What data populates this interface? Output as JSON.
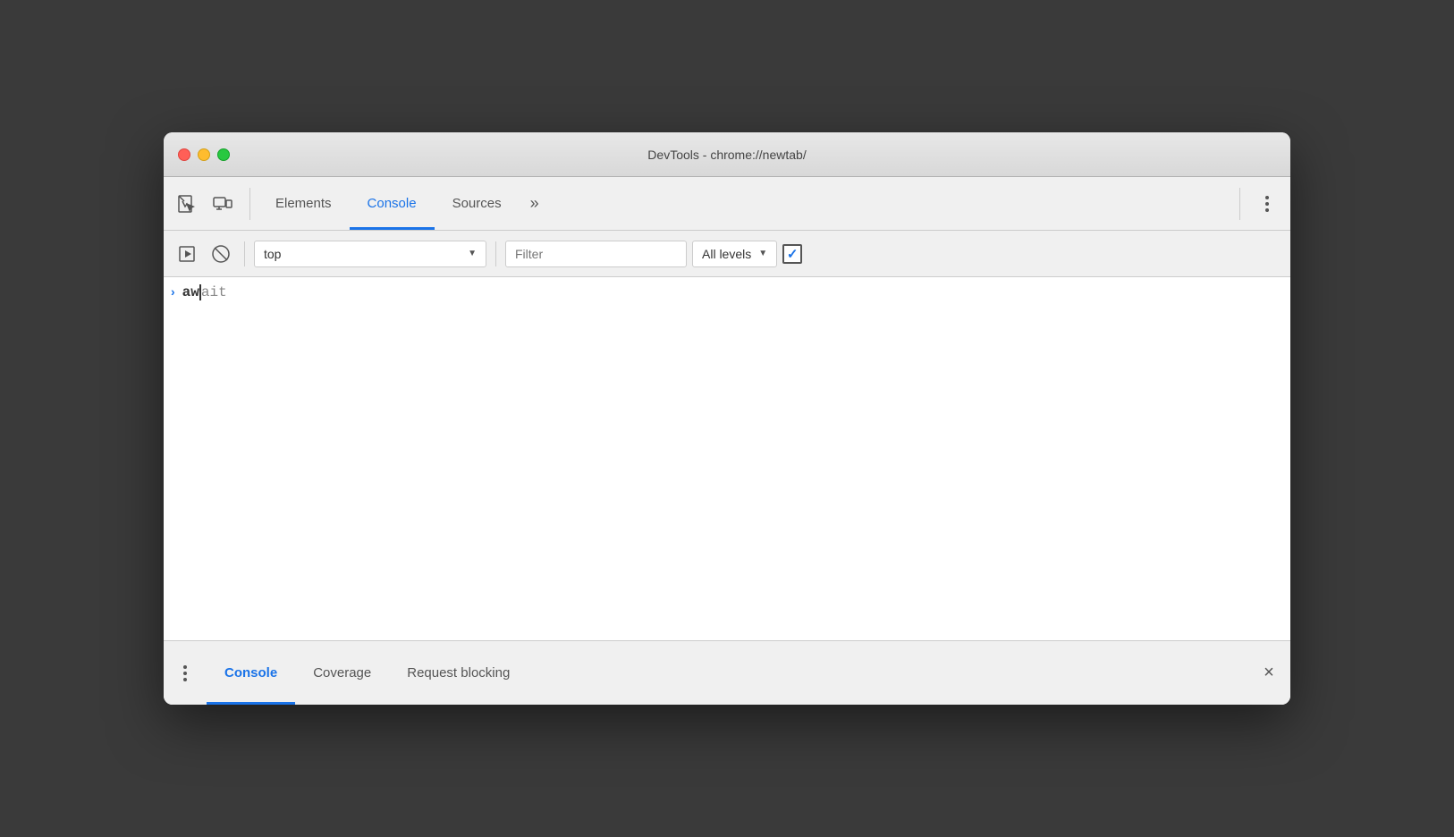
{
  "window": {
    "title": "DevTools - chrome://newtab/"
  },
  "titleBar": {
    "close_label": "",
    "minimize_label": "",
    "maximize_label": ""
  },
  "mainToolbar": {
    "tabs": [
      {
        "label": "Elements",
        "active": false
      },
      {
        "label": "Console",
        "active": true
      },
      {
        "label": "Sources",
        "active": false
      }
    ],
    "more_tabs_label": "»",
    "more_options_label": "⋮"
  },
  "consoleToolbar": {
    "context_value": "top",
    "filter_placeholder": "Filter",
    "levels_label": "All levels",
    "checkbox_checked": true
  },
  "consoleArea": {
    "prompt_chevron": "›",
    "input_typed": "aw",
    "input_suggestion": "ait"
  },
  "bottomPanel": {
    "tabs": [
      {
        "label": "Console",
        "active": true
      },
      {
        "label": "Coverage",
        "active": false
      },
      {
        "label": "Request blocking",
        "active": false
      }
    ],
    "close_label": "×"
  }
}
